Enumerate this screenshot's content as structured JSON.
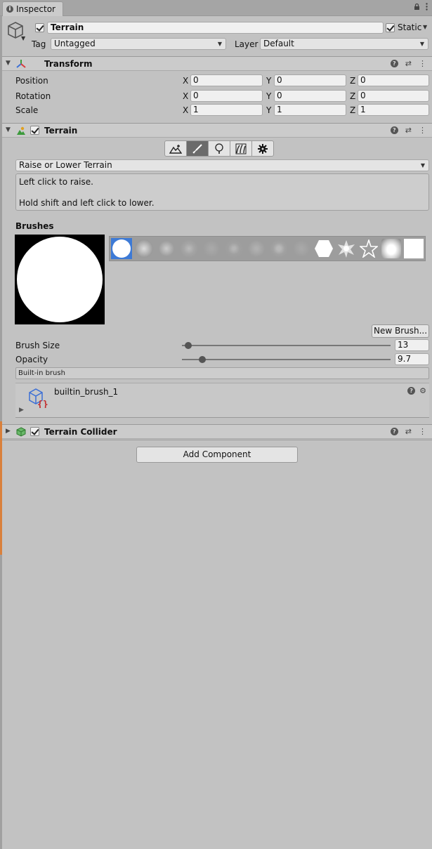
{
  "tab": {
    "title": "Inspector"
  },
  "game_object": {
    "name": "Terrain",
    "static_label": "Static",
    "tag_label": "Tag",
    "tag_value": "Untagged",
    "layer_label": "Layer",
    "layer_value": "Default"
  },
  "transform": {
    "title": "Transform",
    "rows": [
      {
        "label": "Position",
        "x": "0",
        "y": "0",
        "z": "0"
      },
      {
        "label": "Rotation",
        "x": "0",
        "y": "0",
        "z": "0"
      },
      {
        "label": "Scale",
        "x": "1",
        "y": "1",
        "z": "1"
      }
    ],
    "axis": {
      "x": "X",
      "y": "Y",
      "z": "Z"
    }
  },
  "terrain": {
    "title": "Terrain",
    "tools": [
      "raise-lower-tool-icon",
      "paint-brush-tool-icon",
      "place-trees-tool-icon",
      "paint-details-tool-icon",
      "terrain-settings-tool-icon"
    ],
    "active_tool_index": 1,
    "mode_value": "Raise or Lower Terrain",
    "help_line1": "Left click to raise.",
    "help_line2": "Hold shift and left click to lower.",
    "brushes_title": "Brushes",
    "new_brush_label": "New Brush...",
    "brush_size_label": "Brush Size",
    "brush_size_value": "13",
    "brush_size_fraction": 0.03,
    "opacity_label": "Opacity",
    "opacity_value": "9.7",
    "opacity_fraction": 0.097,
    "builtin_label": "Built-in brush",
    "asset_name": "builtin_brush_1"
  },
  "terrain_collider": {
    "title": "Terrain Collider"
  },
  "add_component_label": "Add Component",
  "colors": {
    "selected_brush": "#3d7ad6",
    "background": "#c2c2c2"
  }
}
